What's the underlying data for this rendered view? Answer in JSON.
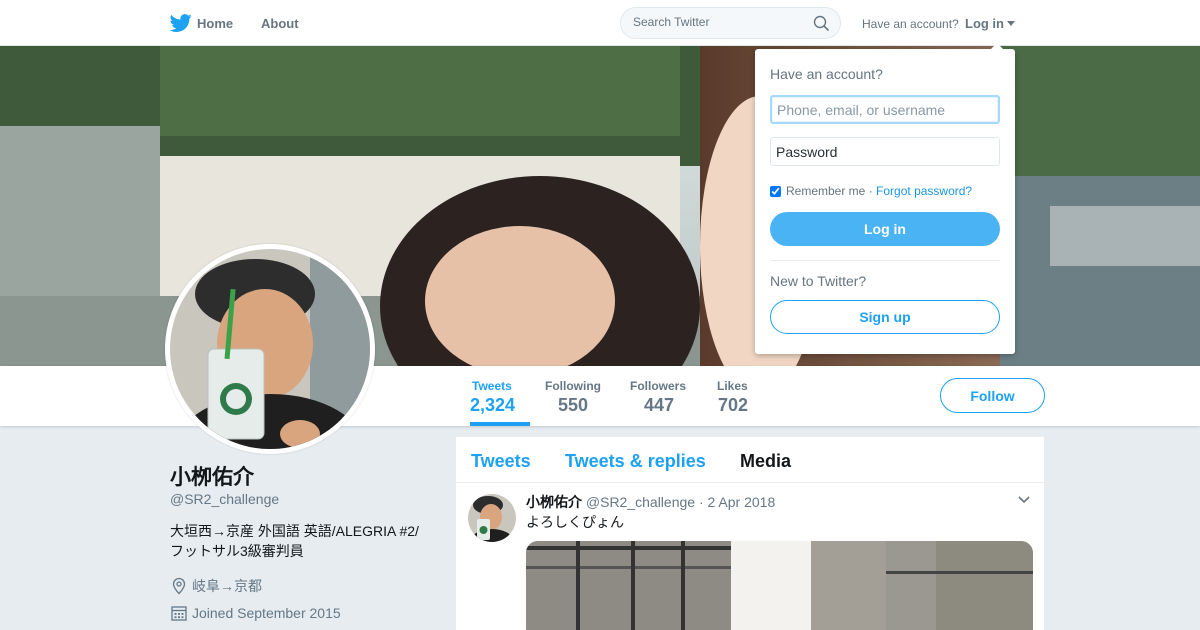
{
  "topnav": {
    "home_label": "Home",
    "about_label": "About",
    "search_placeholder": "Search Twitter",
    "have_account": "Have an account?",
    "login_label": "Log in"
  },
  "profile": {
    "name": "小栁佑介",
    "handle": "@SR2_challenge",
    "bio_line1": "大垣西→京産 外国語 英語/ALEGRIA #2/",
    "bio_line2": "フットサル3級審判員",
    "location": "岐阜→京都",
    "joined": "Joined September 2015"
  },
  "stats": [
    {
      "label": "Tweets",
      "value": "2,324"
    },
    {
      "label": "Following",
      "value": "550"
    },
    {
      "label": "Followers",
      "value": "447"
    },
    {
      "label": "Likes",
      "value": "702"
    }
  ],
  "follow_label": "Follow",
  "timeline": {
    "tabs": [
      "Tweets",
      "Tweets & replies",
      "Media"
    ],
    "tweet": {
      "fullname": "小栁佑介",
      "username": "@SR2_challenge",
      "separator": "·",
      "date": "2 Apr 2018",
      "text": "よろしくぴょん"
    }
  },
  "login_dropdown": {
    "title": "Have an account?",
    "username_placeholder": "Phone, email, or username",
    "password_placeholder": "Password",
    "remember_label": "Remember me",
    "separator": "·",
    "forgot_label": "Forgot password?",
    "login_button": "Log in",
    "new_label": "New to Twitter?",
    "signup_button": "Sign up"
  },
  "colors": {
    "accent": "#1da1f2",
    "background": "#e6ecf0",
    "muted": "#657786"
  }
}
